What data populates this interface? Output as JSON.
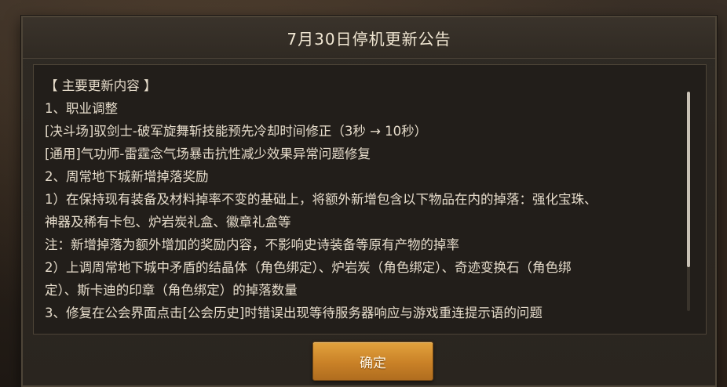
{
  "dialog": {
    "title": "7月30日停机更新公告",
    "content_lines": [
      "【 主要更新内容 】",
      "1、职业调整",
      "[决斗场]驭剑士-破军旋舞斩技能预先冷却时间修正（3秒 → 10秒）",
      "[通用]气功师-雷霆念气场暴击抗性减少效果异常问题修复",
      "2、周常地下城新增掉落奖励",
      "1）在保持现有装备及材料掉率不变的基础上，将额外新增包含以下物品在内的掉落：强化宝珠、",
      "神器及稀有卡包、炉岩炭礼盒、徽章礼盒等",
      "注：新增掉落为额外增加的奖励内容，不影响史诗装备等原有产物的掉率",
      "2）上调周常地下城中矛盾的结晶体（角色绑定）、炉岩炭（角色绑定）、奇迹变换石（角色绑",
      "定）、斯卡迪的印章（角色绑定）的掉落数量",
      "3、修复在公会界面点击[公会历史]时错误出现等待服务器响应与游戏重连提示语的问题"
    ],
    "confirm_label": "确定",
    "scroll_position": 0.0
  }
}
